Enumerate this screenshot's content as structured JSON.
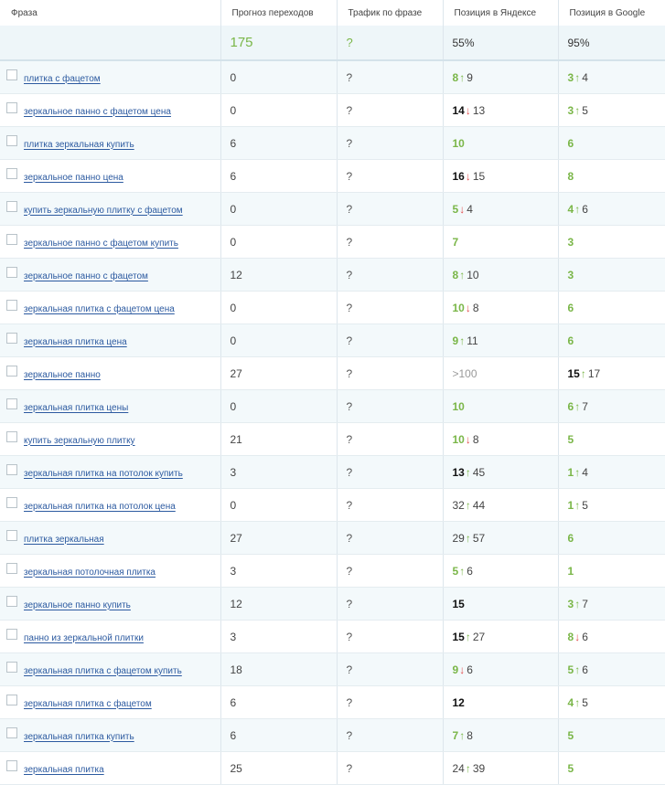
{
  "header": {
    "phrase": "Фраза",
    "forecast": "Прогноз переходов",
    "traffic": "Трафик по фразе",
    "yandex": "Позиция в Яндексе",
    "google": "Позиция в Google"
  },
  "summary": {
    "phrase": "",
    "forecast": "175",
    "traffic": "?",
    "yandex": "55%",
    "google": "95%"
  },
  "rows": [
    {
      "phrase": "плитка с фацетом",
      "forecast": "0",
      "traffic": "?",
      "yandex": {
        "pos": "8",
        "style": "green",
        "dir": "up",
        "prev": "9"
      },
      "google": {
        "pos": "3",
        "style": "green",
        "dir": "up",
        "prev": "4"
      }
    },
    {
      "phrase": "зеркальное панно с фацетом цена",
      "forecast": "0",
      "traffic": "?",
      "yandex": {
        "pos": "14",
        "style": "black",
        "dir": "down",
        "prev": "13"
      },
      "google": {
        "pos": "3",
        "style": "green",
        "dir": "up",
        "prev": "5"
      }
    },
    {
      "phrase": "плитка зеркальная купить",
      "forecast": "6",
      "traffic": "?",
      "yandex": {
        "pos": "10",
        "style": "green",
        "dir": "",
        "prev": ""
      },
      "google": {
        "pos": "6",
        "style": "green",
        "dir": "",
        "prev": ""
      }
    },
    {
      "phrase": "зеркальное панно цена",
      "forecast": "6",
      "traffic": "?",
      "yandex": {
        "pos": "16",
        "style": "black",
        "dir": "down",
        "prev": "15"
      },
      "google": {
        "pos": "8",
        "style": "green",
        "dir": "",
        "prev": ""
      }
    },
    {
      "phrase": "купить зеркальную плитку с фацетом",
      "forecast": "0",
      "traffic": "?",
      "yandex": {
        "pos": "5",
        "style": "green",
        "dir": "down",
        "prev": "4"
      },
      "google": {
        "pos": "4",
        "style": "green",
        "dir": "up",
        "prev": "6"
      }
    },
    {
      "phrase": "зеркальное панно с фацетом купить",
      "forecast": "0",
      "traffic": "?",
      "yandex": {
        "pos": "7",
        "style": "green",
        "dir": "",
        "prev": ""
      },
      "google": {
        "pos": "3",
        "style": "green",
        "dir": "",
        "prev": ""
      }
    },
    {
      "phrase": "зеркальное панно с фацетом",
      "forecast": "12",
      "traffic": "?",
      "yandex": {
        "pos": "8",
        "style": "green",
        "dir": "up",
        "prev": "10"
      },
      "google": {
        "pos": "3",
        "style": "green",
        "dir": "",
        "prev": ""
      }
    },
    {
      "phrase": "зеркальная плитка с фацетом цена",
      "forecast": "0",
      "traffic": "?",
      "yandex": {
        "pos": "10",
        "style": "green",
        "dir": "down",
        "prev": "8"
      },
      "google": {
        "pos": "6",
        "style": "green",
        "dir": "",
        "prev": ""
      }
    },
    {
      "phrase": "зеркальная плитка цена",
      "forecast": "0",
      "traffic": "?",
      "yandex": {
        "pos": "9",
        "style": "green",
        "dir": "up",
        "prev": "11"
      },
      "google": {
        "pos": "6",
        "style": "green",
        "dir": "",
        "prev": ""
      }
    },
    {
      "phrase": "зеркальное панно",
      "forecast": "27",
      "traffic": "?",
      "yandex": {
        "pos": ">100",
        "style": "gt",
        "dir": "",
        "prev": ""
      },
      "google": {
        "pos": "15",
        "style": "black",
        "dir": "up",
        "prev": "17"
      }
    },
    {
      "phrase": "зеркальная плитка цены",
      "forecast": "0",
      "traffic": "?",
      "yandex": {
        "pos": "10",
        "style": "green",
        "dir": "",
        "prev": ""
      },
      "google": {
        "pos": "6",
        "style": "green",
        "dir": "up",
        "prev": "7"
      }
    },
    {
      "phrase": "купить зеркальную плитку",
      "forecast": "21",
      "traffic": "?",
      "yandex": {
        "pos": "10",
        "style": "green",
        "dir": "down",
        "prev": "8"
      },
      "google": {
        "pos": "5",
        "style": "green",
        "dir": "",
        "prev": ""
      }
    },
    {
      "phrase": "зеркальная плитка на потолок купить",
      "forecast": "3",
      "traffic": "?",
      "yandex": {
        "pos": "13",
        "style": "black",
        "dir": "up",
        "prev": "45"
      },
      "google": {
        "pos": "1",
        "style": "green",
        "dir": "up",
        "prev": "4"
      }
    },
    {
      "phrase": "зеркальная плитка на потолок цена",
      "forecast": "0",
      "traffic": "?",
      "yandex": {
        "pos": "32",
        "style": "gray",
        "dir": "up",
        "prev": "44"
      },
      "google": {
        "pos": "1",
        "style": "green",
        "dir": "up",
        "prev": "5"
      }
    },
    {
      "phrase": "плитка зеркальная",
      "forecast": "27",
      "traffic": "?",
      "yandex": {
        "pos": "29",
        "style": "gray",
        "dir": "up",
        "prev": "57"
      },
      "google": {
        "pos": "6",
        "style": "green",
        "dir": "",
        "prev": ""
      }
    },
    {
      "phrase": "зеркальная потолочная плитка",
      "forecast": "3",
      "traffic": "?",
      "yandex": {
        "pos": "5",
        "style": "green",
        "dir": "up",
        "prev": "6"
      },
      "google": {
        "pos": "1",
        "style": "green",
        "dir": "",
        "prev": ""
      }
    },
    {
      "phrase": "зеркальное панно купить",
      "forecast": "12",
      "traffic": "?",
      "yandex": {
        "pos": "15",
        "style": "black",
        "dir": "",
        "prev": ""
      },
      "google": {
        "pos": "3",
        "style": "green",
        "dir": "up",
        "prev": "7"
      }
    },
    {
      "phrase": "панно из зеркальной плитки",
      "forecast": "3",
      "traffic": "?",
      "yandex": {
        "pos": "15",
        "style": "black",
        "dir": "up",
        "prev": "27"
      },
      "google": {
        "pos": "8",
        "style": "green",
        "dir": "down",
        "prev": "6"
      }
    },
    {
      "phrase": "зеркальная плитка с фацетом купить",
      "forecast": "18",
      "traffic": "?",
      "yandex": {
        "pos": "9",
        "style": "green",
        "dir": "down",
        "prev": "6"
      },
      "google": {
        "pos": "5",
        "style": "green",
        "dir": "up",
        "prev": "6"
      }
    },
    {
      "phrase": "зеркальная плитка с фацетом",
      "forecast": "6",
      "traffic": "?",
      "yandex": {
        "pos": "12",
        "style": "black",
        "dir": "",
        "prev": ""
      },
      "google": {
        "pos": "4",
        "style": "green",
        "dir": "up",
        "prev": "5"
      }
    },
    {
      "phrase": "зеркальная плитка купить",
      "forecast": "6",
      "traffic": "?",
      "yandex": {
        "pos": "7",
        "style": "green",
        "dir": "up",
        "prev": "8"
      },
      "google": {
        "pos": "5",
        "style": "green",
        "dir": "",
        "prev": ""
      }
    },
    {
      "phrase": "зеркальная плитка",
      "forecast": "25",
      "traffic": "?",
      "yandex": {
        "pos": "24",
        "style": "gray",
        "dir": "up",
        "prev": "39"
      },
      "google": {
        "pos": "5",
        "style": "green",
        "dir": "",
        "prev": ""
      }
    }
  ],
  "arrows": {
    "up": "↑",
    "down": "↓"
  },
  "colors": {
    "green": "#7ab648",
    "red": "#e24c4c",
    "link": "#2c5aa0",
    "row_alt": "#f3f9fb"
  }
}
